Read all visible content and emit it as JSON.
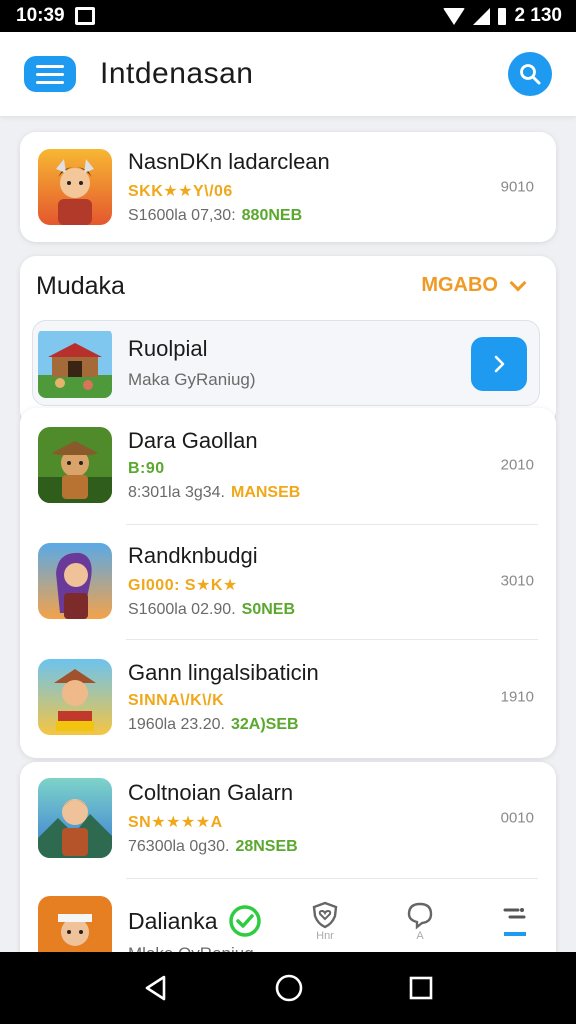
{
  "status_bar": {
    "time": "10:39",
    "battery": "2 130"
  },
  "app_bar": {
    "title": "Intdenasan"
  },
  "top_card": {
    "title": "NasnDKn ladarclean",
    "tag": "SKK★★Y\\/06",
    "meta": "S1600la 07,30:",
    "price": "880NEB",
    "count": "9010"
  },
  "section": {
    "title": "Mudaka",
    "sort_label": "MGABO"
  },
  "featured": {
    "title": "Ruolpial",
    "subtitle": "Maka GyRaniug)"
  },
  "list": [
    {
      "title": "Dara Gaollan",
      "tag": "B:90",
      "tag_color": "green",
      "meta": "8:301la 3g34.",
      "price": "MANSEB",
      "price_color": "orange",
      "count": "2010"
    },
    {
      "title": "Randknbudgi",
      "tag": "GI000: S★K★",
      "tag_color": "orange",
      "meta": "S1600la 02.90.",
      "price": "S0NEB",
      "price_color": "green",
      "count": "3010"
    },
    {
      "title": "Gann lingalsibaticin",
      "tag": "SINNA\\/K\\/K",
      "tag_color": "orange",
      "meta": "1960la 23.20.",
      "price": "32A)SEB",
      "price_color": "green",
      "count": "1910"
    },
    {
      "title": "Coltnoian Galarn",
      "tag": "SN★★★★A",
      "tag_color": "orange",
      "meta": "76300la 0g30.",
      "price": "28NSEB",
      "price_color": "green",
      "count": "0010"
    },
    {
      "title": "Dalianka",
      "tag": "",
      "tag_color": "orange",
      "meta": "Mlake OyRepiug",
      "price": "",
      "price_color": "green",
      "count": ""
    }
  ],
  "bottom_tabs": [
    {
      "icon": "shield-heart-icon",
      "label": "Hnr"
    },
    {
      "icon": "chat-bubble-icon",
      "label": "A"
    },
    {
      "icon": "filter-icon",
      "label": ""
    }
  ],
  "colors": {
    "accent": "#1e9bf0",
    "orange": "#f09a26",
    "green": "#5aa82e"
  }
}
